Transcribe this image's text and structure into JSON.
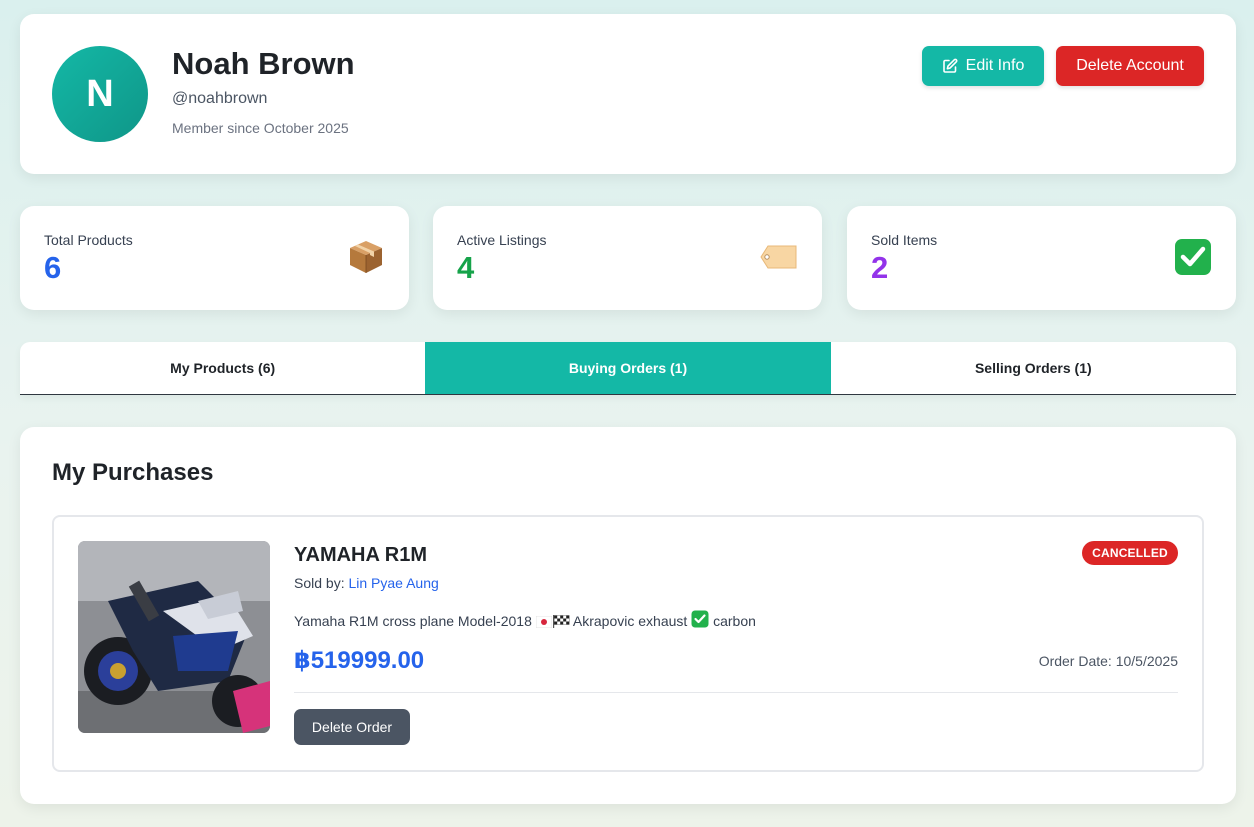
{
  "profile": {
    "initial": "N",
    "name": "Noah Brown",
    "handle": "@noahbrown",
    "member_since": "Member since October 2025",
    "edit_label": "Edit Info",
    "delete_account_label": "Delete Account"
  },
  "stats": [
    {
      "label": "Total Products",
      "value": "6",
      "icon": "package-icon",
      "color": "#2563eb"
    },
    {
      "label": "Active Listings",
      "value": "4",
      "icon": "tag-icon",
      "color": "#16a34a"
    },
    {
      "label": "Sold Items",
      "value": "2",
      "icon": "check-mark-icon",
      "color": "#9333ea"
    }
  ],
  "tabs": [
    {
      "label": "My Products (6)",
      "active": false
    },
    {
      "label": "Buying Orders (1)",
      "active": true
    },
    {
      "label": "Selling Orders (1)",
      "active": false
    }
  ],
  "purchases": {
    "title": "My Purchases",
    "orders": [
      {
        "product_name": "YAMAHA R1M",
        "status": "CANCELLED",
        "sold_by_label": "Sold by:",
        "seller": "Lin Pyae Aung",
        "description_part1": "Yamaha R1M cross plane Model-2018",
        "description_part2": "Akrapovic exhaust",
        "description_part3": "carbon",
        "price": "฿519999.00",
        "order_date": "Order Date: 10/5/2025",
        "delete_label": "Delete Order"
      }
    ]
  },
  "colors": {
    "accent": "#14b8a6",
    "danger": "#dc2626",
    "link": "#2563eb"
  }
}
